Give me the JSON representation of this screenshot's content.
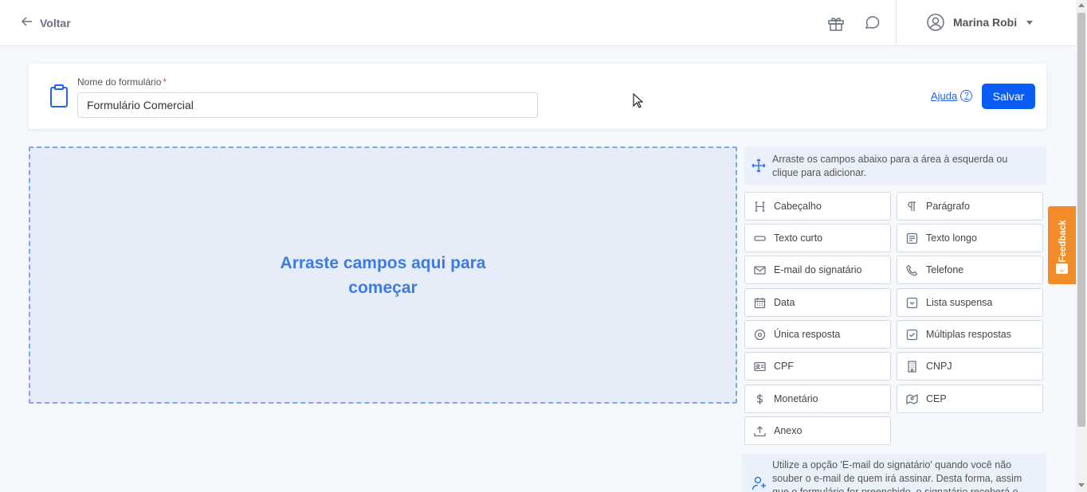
{
  "topbar": {
    "back_label": "Voltar",
    "user_name": "Marina Robi"
  },
  "form": {
    "name_label": "Nome do formulário",
    "required_mark": "*",
    "name_value": "Formulário Comercial",
    "help_label": "Ajuda",
    "help_glyph": "?",
    "save_label": "Salvar"
  },
  "dropzone": {
    "message": "Arraste campos aqui para começar"
  },
  "panel": {
    "hint": "Arraste os campos abaixo para a área à esquerda ou clique para adicionar.",
    "fields": [
      {
        "label": "Cabeçalho",
        "icon": "heading-icon"
      },
      {
        "label": "Parágrafo",
        "icon": "paragraph-icon"
      },
      {
        "label": "Texto curto",
        "icon": "short-text-icon"
      },
      {
        "label": "Texto longo",
        "icon": "long-text-icon"
      },
      {
        "label": "E-mail do signatário",
        "icon": "envelope-icon"
      },
      {
        "label": "Telefone",
        "icon": "phone-icon"
      },
      {
        "label": "Data",
        "icon": "calendar-icon"
      },
      {
        "label": "Lista suspensa",
        "icon": "dropdown-icon"
      },
      {
        "label": "Única resposta",
        "icon": "radio-icon"
      },
      {
        "label": "Múltiplas respostas",
        "icon": "checkbox-icon"
      },
      {
        "label": "CPF",
        "icon": "id-card-icon"
      },
      {
        "label": "CNPJ",
        "icon": "building-icon"
      },
      {
        "label": "Monetário",
        "icon": "dollar-icon"
      },
      {
        "label": "CEP",
        "icon": "map-icon"
      },
      {
        "label": "Anexo",
        "icon": "upload-icon"
      }
    ],
    "tip": "Utilize a opção 'E-mail do signatário' quando você não souber o e-mail de quem irá assinar. Desta forma, assim que o formulário for preenchido, o signatário receberá o"
  },
  "feedback": {
    "label": "Feedback",
    "color": "#f28c28"
  },
  "colors": {
    "primary": "#0b5cf5",
    "dropzone_text": "#3d7be0"
  }
}
